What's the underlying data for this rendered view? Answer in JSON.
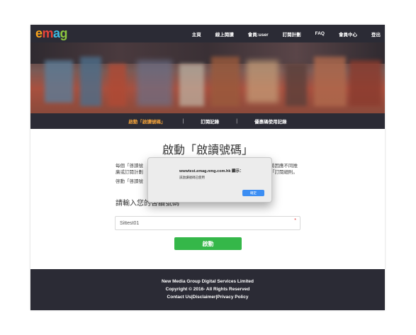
{
  "logo": {
    "text": "emag",
    "letters": [
      "e",
      "m",
      "a",
      "g"
    ]
  },
  "nav": {
    "items": [
      "主頁",
      "線上閱讀",
      "會員:user",
      "訂閱計劃",
      "FAQ",
      "會員中心",
      "登出"
    ]
  },
  "subnav": {
    "items": [
      "啟動「啟讀號碼」",
      "訂閱記錄",
      "優惠碼使用記錄"
    ],
    "separator": "|"
  },
  "main": {
    "title": "啟動「啟讀號碼」",
    "desc_line1": "每個「啓讀號",
    "desc_line2": "廣或訂閱計劃",
    "desc_line3": "啓動「啓讀號",
    "desc_right1": "將因應不同推",
    "desc_right2": "「訂閱細則。",
    "input_label": "請輸入您的啓讀號碼",
    "input_value": "Sittest01",
    "required_mark": "*",
    "activate_label": "啟動"
  },
  "footer": {
    "line1": "New Media Group Digital Services Limited",
    "line2": "Copyright © 2016- All Rights Reserved",
    "line3": "Contact Us|Disclaimer|Privacy Policy"
  },
  "dialog": {
    "title": "wwwtest.emag.nmg.com.hk 顯示：",
    "message": "該啟讀號碼已使用",
    "ok_label": "確定"
  },
  "colors": {
    "nav_bg": "#2b2b35",
    "active_subnav": "#f2a23b",
    "button_green": "#35b749",
    "dialog_button": "#3c8ef3"
  }
}
